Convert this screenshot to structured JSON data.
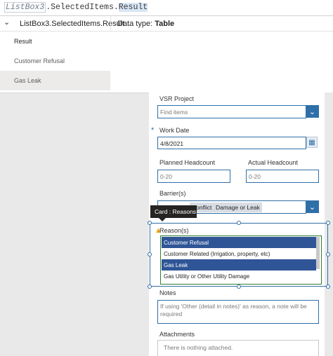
{
  "formula": {
    "identifier": "ListBox3",
    "dot1": ".",
    "property": "SelectedItems",
    "dot2": ".",
    "result": "Result"
  },
  "intellisense": {
    "path": "ListBox3.SelectedItems.Result",
    "datatype_label": "Data type:",
    "datatype_value": "Table",
    "column_header": "Result",
    "rows": [
      "Customer Refusal",
      "Gas Leak"
    ]
  },
  "form": {
    "vsr_project_label": "VSR Project",
    "vsr_project_placeholder": "Find items",
    "work_date_label": "Work Date",
    "work_date_value": "4/8/2021",
    "planned_headcount_label": "Planned Headcount",
    "planned_headcount_placeholder": "0-20",
    "actual_headcount_label": "Actual Headcount",
    "actual_headcount_placeholder": "0-20",
    "barriers_label": "Barrier(s)",
    "barriers_chips": [
      "Conflict",
      "Damage or Leak"
    ],
    "reasons_label": "Reason(s)",
    "reasons_items": [
      "Customer Refusal",
      "Customer Related (Irrigation, property, etc)",
      "Gas Leak",
      "Gas Utility or Other Utility Damage"
    ],
    "notes_label": "Notes",
    "notes_placeholder": "If using 'Other (detail in notes)' as reason, a note will be required",
    "attachments_label": "Attachments",
    "attachments_empty": "There is nothing attached."
  },
  "tooltip": {
    "text": "Card : Reasons"
  },
  "icons": {
    "chevron": "chevron-down-icon",
    "calendar": "calendar-icon",
    "warning": "warning-icon",
    "required": "asterisk-icon"
  },
  "colors": {
    "accent": "#2f6fa8",
    "selected": "#2f5597",
    "tooltip_bg": "#252423",
    "warning": "#f0a30a"
  }
}
